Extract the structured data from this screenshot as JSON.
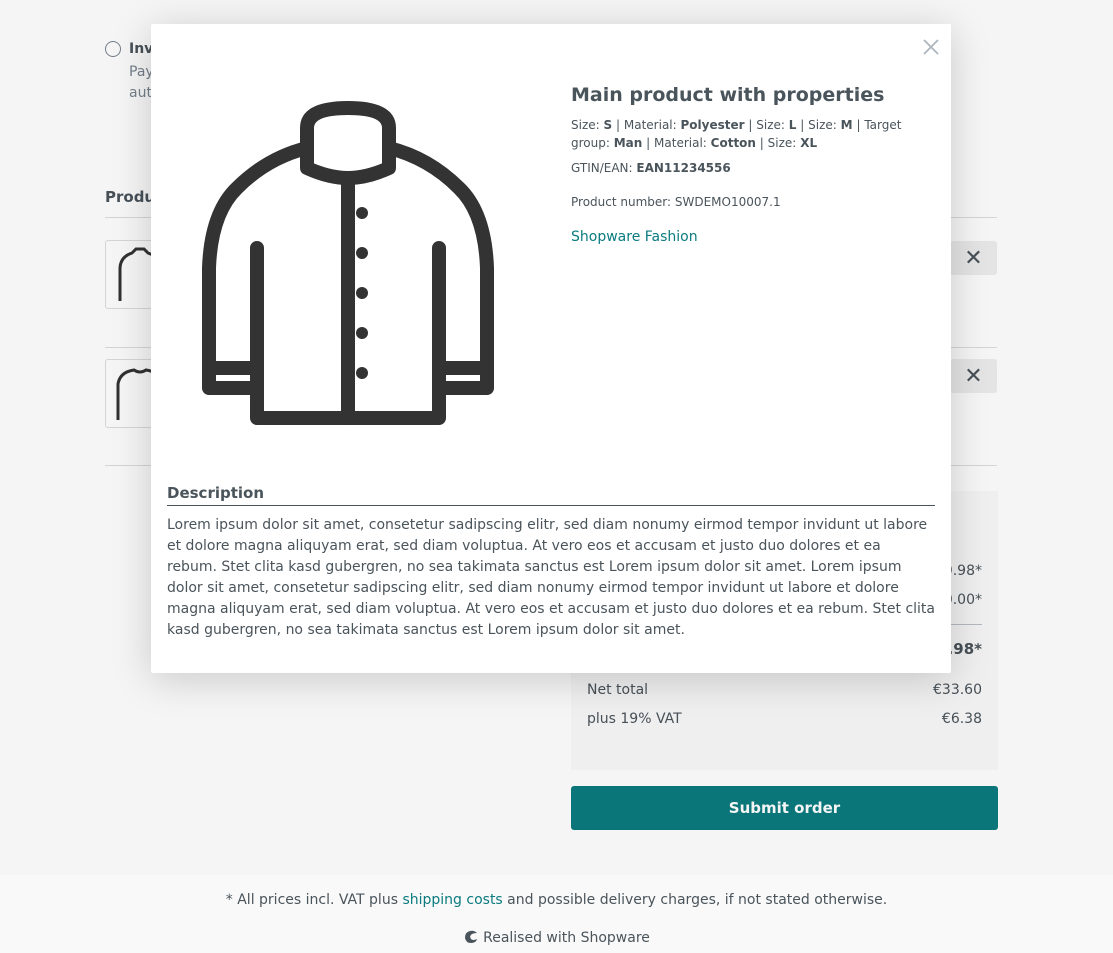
{
  "payment": {
    "option_title": "Inv",
    "option_desc": "Pay\naut"
  },
  "products": {
    "heading": "Produ"
  },
  "summary": {
    "rows": [
      {
        "label": "",
        "value": "9.98*"
      },
      {
        "label": "",
        "value": "0.00*"
      }
    ],
    "total": {
      "label": "",
      "value": ".98*"
    },
    "net": {
      "label": "Net total",
      "value": "€33.60"
    },
    "vat": {
      "label": "plus 19% VAT",
      "value": "€6.38"
    }
  },
  "submit_label": "Submit order",
  "footer": {
    "note_prefix": "* All prices incl. VAT plus ",
    "note_link": "shipping costs",
    "note_suffix": " and possible delivery charges, if not stated otherwise.",
    "brand": "Realised with Shopware"
  },
  "modal": {
    "close_label": "×",
    "title": "Main product with properties",
    "variants": [
      {
        "label": "Size:",
        "value": "S"
      },
      {
        "label": "Material:",
        "value": "Polyester"
      },
      {
        "label": "Size:",
        "value": "L"
      },
      {
        "label": "Size:",
        "value": "M"
      },
      {
        "label": "Target group:",
        "value": "Man"
      },
      {
        "label": "Material:",
        "value": "Cotton"
      },
      {
        "label": "Size:",
        "value": "XL"
      }
    ],
    "gtin_label": "GTIN/EAN:",
    "gtin_value": "EAN11234556",
    "product_number": "Product number: SWDEMO10007.1",
    "manufacturer": "Shopware Fashion",
    "description_title": "Description",
    "description": "Lorem ipsum dolor sit amet, consetetur sadipscing elitr, sed diam nonumy eirmod tempor invidunt ut labore et dolore magna aliquyam erat, sed diam voluptua. At vero eos et accusam et justo duo dolores et ea rebum. Stet clita kasd gubergren, no sea takimata sanctus est Lorem ipsum dolor sit amet. Lorem ipsum dolor sit amet, consetetur sadipscing elitr, sed diam nonumy eirmod tempor invidunt ut labore et dolore magna aliquyam erat, sed diam voluptua. At vero eos et accusam et justo duo dolores et ea rebum. Stet clita kasd gubergren, no sea takimata sanctus est Lorem ipsum dolor sit amet."
  },
  "icons": {
    "close": "close-icon",
    "remove": "close-icon",
    "brand_logo": "shopware-logo-icon"
  },
  "colors": {
    "accent": "#0b7b7f",
    "text": "#4a545b"
  }
}
